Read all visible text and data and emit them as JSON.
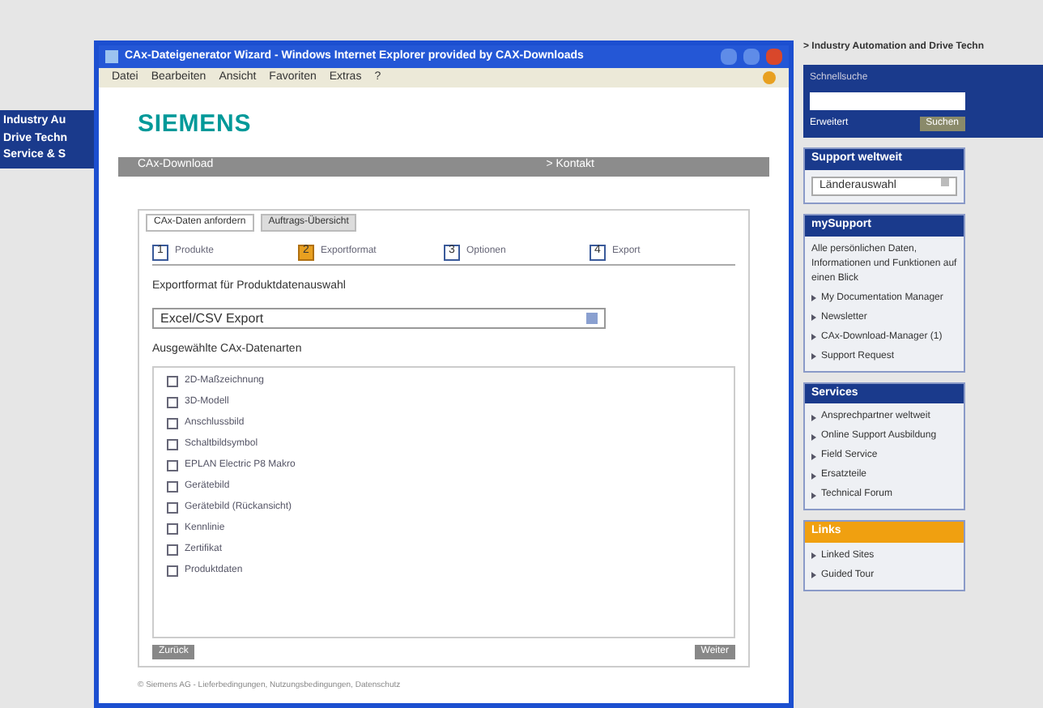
{
  "background_page": {
    "left_nav": [
      "Industry Au",
      "Drive Techn",
      "Service & S"
    ],
    "breadcrumb": "> Industry Automation and Drive Techn",
    "search": {
      "label": "Schnellsuche",
      "advanced_link": "Erweitert",
      "button": "Suchen"
    },
    "support_box": {
      "title": "Support weltweit",
      "select": "Länderauswahl"
    },
    "mysupport_box": {
      "title": "mySupport",
      "intro": "Alle persönlichen Daten, Informationen und Funktionen auf einen Blick",
      "items": [
        {
          "label": "My Documentation Manager"
        },
        {
          "label": "Newsletter"
        },
        {
          "label": "CAx-Download-Manager (1)"
        },
        {
          "label": "Support Request"
        }
      ]
    },
    "services_box": {
      "title": "Services",
      "items": [
        {
          "label": "Ansprechpartner weltweit"
        },
        {
          "label": "Online Support Ausbildung"
        },
        {
          "label": "Field Service"
        },
        {
          "label": "Ersatzteile"
        },
        {
          "label": "Technical Forum"
        }
      ]
    },
    "links_box": {
      "title": "Links",
      "items": [
        {
          "label": "Linked Sites"
        },
        {
          "label": "Guided Tour"
        }
      ]
    }
  },
  "popup": {
    "title": "CAx-Dateigenerator Wizard - Windows Internet Explorer provided by CAX-Downloads",
    "menu": [
      "Datei",
      "Bearbeiten",
      "Ansicht",
      "Favoriten",
      "Extras",
      "?"
    ],
    "logo": "SIEMENS",
    "header_bar": {
      "left": "CAx-Download",
      "right": "> Kontakt"
    },
    "tabs": [
      {
        "label": "CAx-Daten anfordern",
        "selected": true
      },
      {
        "label": "Auftrags-Übersicht",
        "selected": false
      }
    ],
    "steps": [
      {
        "number": "1",
        "label": "Produkte",
        "selected": false
      },
      {
        "number": "2",
        "label": "Exportformat",
        "selected": true
      },
      {
        "number": "3",
        "label": "Optionen",
        "selected": false
      },
      {
        "number": "4",
        "label": "Export",
        "selected": false
      }
    ],
    "format_label": "Exportformat für Produktdatenauswahl",
    "format_select": "Excel/CSV Export",
    "types_label": "Ausgewählte CAx-Datenarten",
    "checkboxes": [
      {
        "label": "2D-Maßzeichnung",
        "checked": false
      },
      {
        "label": "3D-Modell",
        "checked": false
      },
      {
        "label": "Anschlussbild",
        "checked": false
      },
      {
        "label": "Schaltbildsymbol",
        "checked": false
      },
      {
        "label": "EPLAN Electric P8 Makro",
        "checked": false
      },
      {
        "label": "Gerätebild",
        "checked": false
      },
      {
        "label": "Gerätebild (Rückansicht)",
        "checked": false
      },
      {
        "label": "Kennlinie",
        "checked": false
      },
      {
        "label": "Zertifikat",
        "checked": false
      },
      {
        "label": "Produktdaten",
        "checked": false
      }
    ],
    "back_button": "Zurück",
    "next_button": "Weiter",
    "footer": "© Siemens AG - Lieferbedingungen, Nutzungsbedingungen, Datenschutz"
  }
}
